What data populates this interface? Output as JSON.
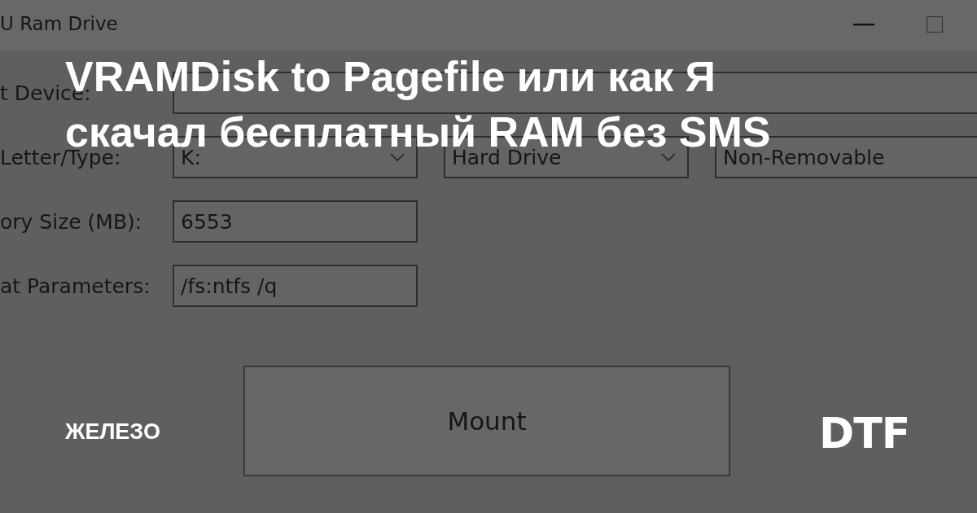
{
  "window": {
    "title": "U Ram Drive"
  },
  "form": {
    "rows": [
      {
        "label": "t Device:",
        "fields": [
          {
            "kind": "text",
            "wide": true
          }
        ]
      },
      {
        "label": "Letter/Type:",
        "fields": [
          {
            "kind": "dropdown",
            "value": "K:"
          },
          {
            "kind": "dropdown",
            "value": "Hard Drive"
          },
          {
            "kind": "text",
            "value": "Non-Removable",
            "wide": true
          }
        ]
      },
      {
        "label": "ory Size (MB):",
        "fields": [
          {
            "kind": "text",
            "value": "6553"
          }
        ]
      },
      {
        "label": "at Parameters:",
        "fields": [
          {
            "kind": "text",
            "value": "/fs:ntfs /q"
          }
        ]
      }
    ]
  },
  "mount_button": {
    "label": "Mount"
  },
  "article": {
    "title_lines": [
      "VRAMDisk to Pagefile или как Я",
      "скачал бесплатный RAM без SMS"
    ],
    "category": "ЖЕЛЕЗО",
    "site": "DTF"
  }
}
